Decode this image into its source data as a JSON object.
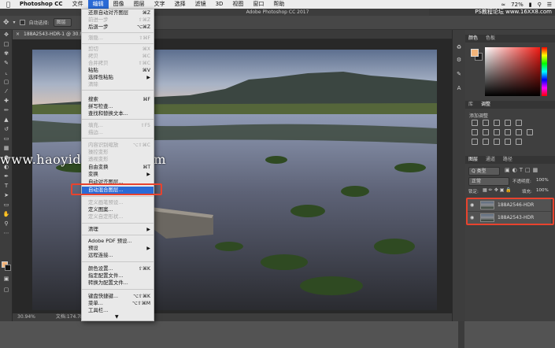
{
  "menubar": {
    "apple": "",
    "app_name": "Photoshop CC",
    "items": [
      "文件",
      "编辑",
      "图像",
      "图层",
      "文字",
      "选择",
      "滤镜",
      "3D",
      "视图",
      "窗口",
      "帮助"
    ],
    "active_index": 1,
    "system": {
      "battery": "72%",
      "site": "PS教程论坛",
      "site_url": "www.16XX8.com"
    }
  },
  "window": {
    "title": "Adobe Photoshop CC 2017"
  },
  "options_bar": {
    "auto_select_label": "自动选择:",
    "auto_select_value": "图层"
  },
  "document": {
    "tab_title": "188A2543-HDR-1 @ 30.9% (188A2543-HDR, RGB/8)",
    "zoom": "30.94%",
    "doc_size": "文档:174.7M/349.4M"
  },
  "watermark": "www.haoyidiansheji.com",
  "edit_menu": {
    "items": [
      {
        "label": "还原自动对齐图层",
        "shortcut": "⌘Z",
        "disabled": false
      },
      {
        "label": "前进一步",
        "shortcut": "⇧⌘Z",
        "disabled": true
      },
      {
        "label": "后退一步",
        "shortcut": "⌥⌘Z",
        "disabled": false
      },
      {
        "sep": true
      },
      {
        "label": "渐隐...",
        "shortcut": "⇧⌘F",
        "disabled": true
      },
      {
        "sep": true
      },
      {
        "label": "剪切",
        "shortcut": "⌘X",
        "disabled": true
      },
      {
        "label": "拷贝",
        "shortcut": "⌘C",
        "disabled": true
      },
      {
        "label": "合并拷贝",
        "shortcut": "⇧⌘C",
        "disabled": true
      },
      {
        "label": "粘贴",
        "shortcut": "⌘V",
        "disabled": false
      },
      {
        "label": "选择性粘贴",
        "shortcut": "▶",
        "disabled": false
      },
      {
        "label": "清除",
        "shortcut": "",
        "disabled": true
      },
      {
        "sep": true
      },
      {
        "label": "搜索",
        "shortcut": "⌘F",
        "disabled": false
      },
      {
        "label": "拼写检查...",
        "shortcut": "",
        "disabled": false
      },
      {
        "label": "查找和替换文本...",
        "shortcut": "",
        "disabled": false
      },
      {
        "sep": true
      },
      {
        "label": "填充...",
        "shortcut": "⇧F5",
        "disabled": true
      },
      {
        "label": "描边...",
        "shortcut": "",
        "disabled": true
      },
      {
        "sep": true
      },
      {
        "label": "内容识别缩放",
        "shortcut": "⌥⇧⌘C",
        "disabled": true
      },
      {
        "label": "操控变形",
        "shortcut": "",
        "disabled": true
      },
      {
        "label": "透视变形",
        "shortcut": "",
        "disabled": true
      },
      {
        "label": "自由变换",
        "shortcut": "⌘T",
        "disabled": false
      },
      {
        "label": "变换",
        "shortcut": "▶",
        "disabled": false
      },
      {
        "label": "自动对齐图层...",
        "shortcut": "",
        "disabled": false
      },
      {
        "label": "自动混合图层...",
        "shortcut": "",
        "disabled": false,
        "highlighted": true
      },
      {
        "sep": true
      },
      {
        "label": "定义画笔预设...",
        "shortcut": "",
        "disabled": true
      },
      {
        "label": "定义图案...",
        "shortcut": "",
        "disabled": false
      },
      {
        "label": "定义自定形状...",
        "shortcut": "",
        "disabled": true
      },
      {
        "sep": true
      },
      {
        "label": "清理",
        "shortcut": "▶",
        "disabled": false
      },
      {
        "sep": true
      },
      {
        "label": "Adobe PDF 预设...",
        "shortcut": "",
        "disabled": false
      },
      {
        "label": "预设",
        "shortcut": "▶",
        "disabled": false
      },
      {
        "label": "远程连接...",
        "shortcut": "",
        "disabled": false
      },
      {
        "sep": true
      },
      {
        "label": "颜色设置...",
        "shortcut": "⇧⌘K",
        "disabled": false
      },
      {
        "label": "指定配置文件...",
        "shortcut": "",
        "disabled": false
      },
      {
        "label": "转换为配置文件...",
        "shortcut": "",
        "disabled": false
      },
      {
        "sep": true
      },
      {
        "label": "键盘快捷键...",
        "shortcut": "⌥⇧⌘K",
        "disabled": false
      },
      {
        "label": "菜单...",
        "shortcut": "⌥⇧⌘M",
        "disabled": false
      },
      {
        "label": "工具栏...",
        "shortcut": "",
        "disabled": false
      }
    ],
    "more_arrow": "▼"
  },
  "panels": {
    "color_tabs": [
      "颜色",
      "色板"
    ],
    "adjust_tabs": [
      "库",
      "调整"
    ],
    "adjust_title": "添加调整",
    "layers_tabs": [
      "图层",
      "通道",
      "路径"
    ],
    "kind_label": "Q 类型",
    "blend_mode": "正常",
    "opacity_label": "不透明度:",
    "opacity_value": "100%",
    "lock_label": "锁定:",
    "fill_label": "填充:",
    "fill_value": "100%",
    "layers": [
      {
        "name": "188A2546-HDR"
      },
      {
        "name": "188A2543-HDR"
      }
    ]
  },
  "colors": {
    "accent": "#2a6ad6",
    "highlight_box": "#e8432e",
    "foreground": "#f2b47a"
  }
}
